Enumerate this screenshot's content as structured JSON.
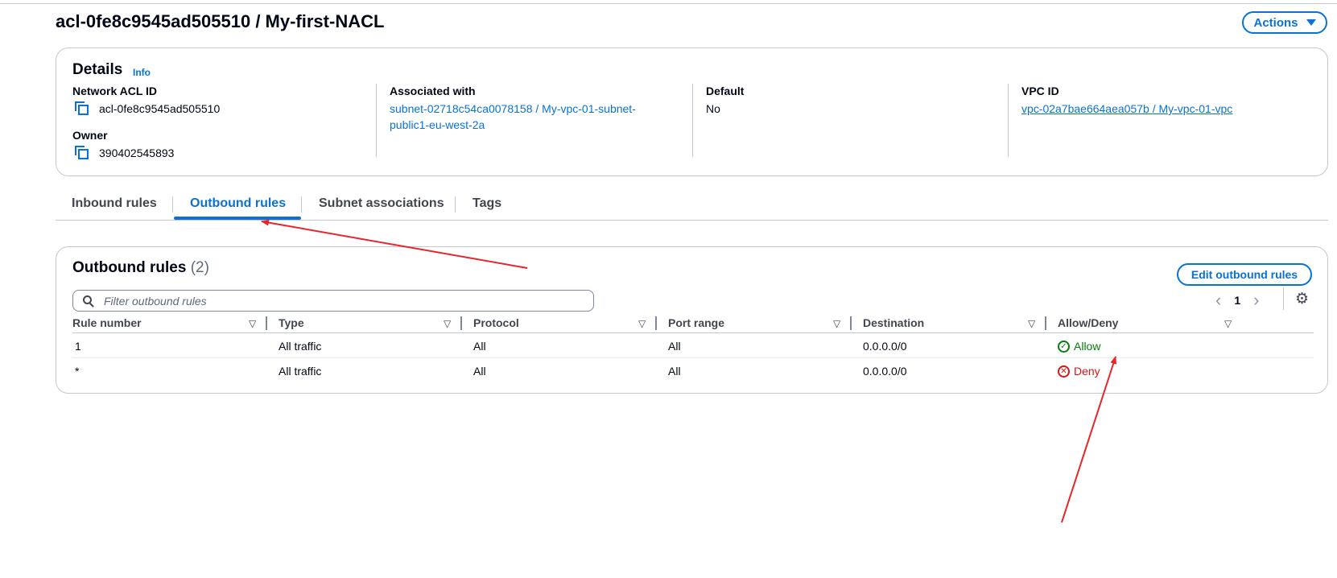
{
  "page": {
    "title": "acl-0fe8c9545ad505510 / My-first-NACL",
    "actions_label": "Actions"
  },
  "details": {
    "title": "Details",
    "info_label": "Info",
    "network_acl_id": {
      "label": "Network ACL ID",
      "value": "acl-0fe8c9545ad505510"
    },
    "owner": {
      "label": "Owner",
      "value": "390402545893"
    },
    "associated_with": {
      "label": "Associated with",
      "value_line1": "subnet-02718c54ca0078158 / My-vpc-01-subnet-",
      "value_line2": "public1-eu-west-2a"
    },
    "default": {
      "label": "Default",
      "value": "No"
    },
    "vpc_id": {
      "label": "VPC ID",
      "value": "vpc-02a7bae664aea057b / My-vpc-01-vpc"
    }
  },
  "tabs": [
    {
      "label": "Inbound rules",
      "active": false
    },
    {
      "label": "Outbound rules",
      "active": true
    },
    {
      "label": "Subnet associations",
      "active": false
    },
    {
      "label": "Tags",
      "active": false
    }
  ],
  "outbound": {
    "title": "Outbound rules",
    "count": "(2)",
    "edit_label": "Edit outbound rules",
    "filter_placeholder": "Filter outbound rules",
    "page_number": "1",
    "columns": [
      "Rule number",
      "Type",
      "Protocol",
      "Port range",
      "Destination",
      "Allow/Deny"
    ],
    "rows": [
      {
        "rule_number": "1",
        "type": "All traffic",
        "protocol": "All",
        "port_range": "All",
        "destination": "0.0.0.0/0",
        "action": "Allow"
      },
      {
        "rule_number": "*",
        "type": "All traffic",
        "protocol": "All",
        "port_range": "All",
        "destination": "0.0.0.0/0",
        "action": "Deny"
      }
    ]
  },
  "colors": {
    "link": "#0972d3",
    "allow": "#037f0c",
    "deny": "#d91515",
    "annotation_arrow": "#e8262a"
  },
  "icons": [
    "copy-icon",
    "search-icon",
    "chevron-left-icon",
    "chevron-right-icon",
    "gear-icon",
    "sort-icon",
    "check-circle-icon",
    "x-circle-icon",
    "caret-down-icon"
  ]
}
